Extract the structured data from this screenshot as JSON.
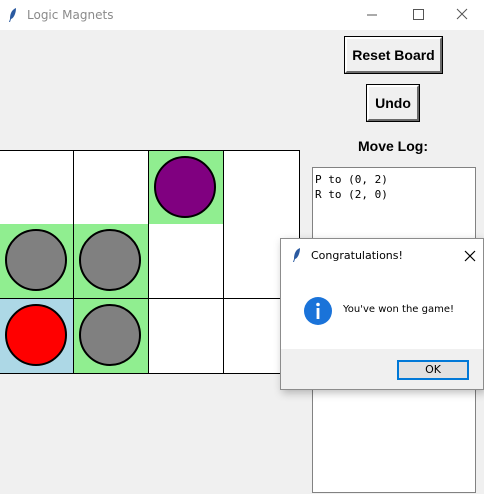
{
  "window": {
    "title": "Logic Magnets"
  },
  "colors": {
    "green_cell": "#90ee90",
    "blue_cell": "#add8e6",
    "white_cell": "#ffffff",
    "purple": "#800080",
    "gray": "#808080",
    "red": "#ff0000"
  },
  "board": {
    "rows": [
      [
        {
          "bg": "white"
        },
        {
          "bg": "white"
        },
        {
          "bg": "green",
          "piece": "purple"
        },
        {
          "bg": "white"
        }
      ],
      [
        {
          "bg": "green",
          "piece": "gray"
        },
        {
          "bg": "green",
          "piece": "gray"
        },
        {
          "bg": "white"
        },
        {
          "bg": "white"
        }
      ],
      [
        {
          "bg": "blue",
          "piece": "red"
        },
        {
          "bg": "green",
          "piece": "gray"
        },
        {
          "bg": "white"
        },
        {
          "bg": "white"
        }
      ]
    ]
  },
  "controls": {
    "reset_label": "Reset Board",
    "undo_label": "Undo",
    "move_log_label": "Move Log:"
  },
  "move_log": [
    "P to (0, 2)",
    "R to (2, 0)"
  ],
  "dialog": {
    "title": "Congratulations!",
    "message": "You've won the game!",
    "ok_label": "OK"
  }
}
